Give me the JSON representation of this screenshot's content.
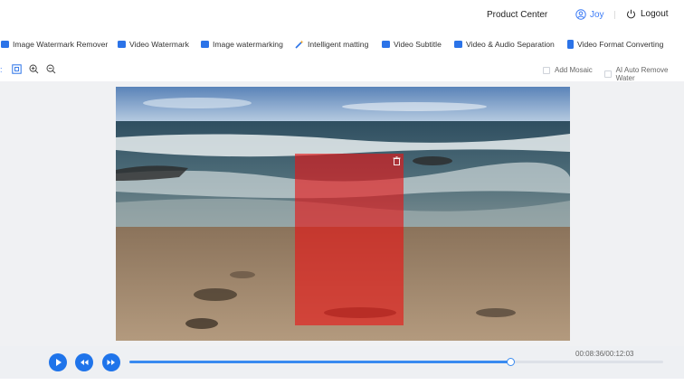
{
  "header": {
    "product_center": "Product Center",
    "user_name": "Joy",
    "logout_label": "Logout"
  },
  "toolbar": {
    "items": [
      {
        "label": "Image Watermark Remover",
        "icon": "image-icon"
      },
      {
        "label": "Video Watermark",
        "icon": "video-icon"
      },
      {
        "label": "Image watermarking",
        "icon": "image-icon"
      },
      {
        "label": "Intelligent matting",
        "icon": "magic-wand-icon"
      },
      {
        "label": "Video Subtitle",
        "icon": "video-icon"
      },
      {
        "label": "Video & Audio Separation",
        "icon": "video-icon"
      },
      {
        "label": "Video Format Converting",
        "icon": "document-icon"
      }
    ]
  },
  "subbar": {
    "add_mosaic": "Add Mosaic",
    "ai_auto_remove": "AI Auto Remove Water"
  },
  "player": {
    "time": "00:08:36/00:12:03",
    "progress": 0.714
  },
  "colors": {
    "accent": "#1f74ea",
    "mask": "#e81414"
  }
}
